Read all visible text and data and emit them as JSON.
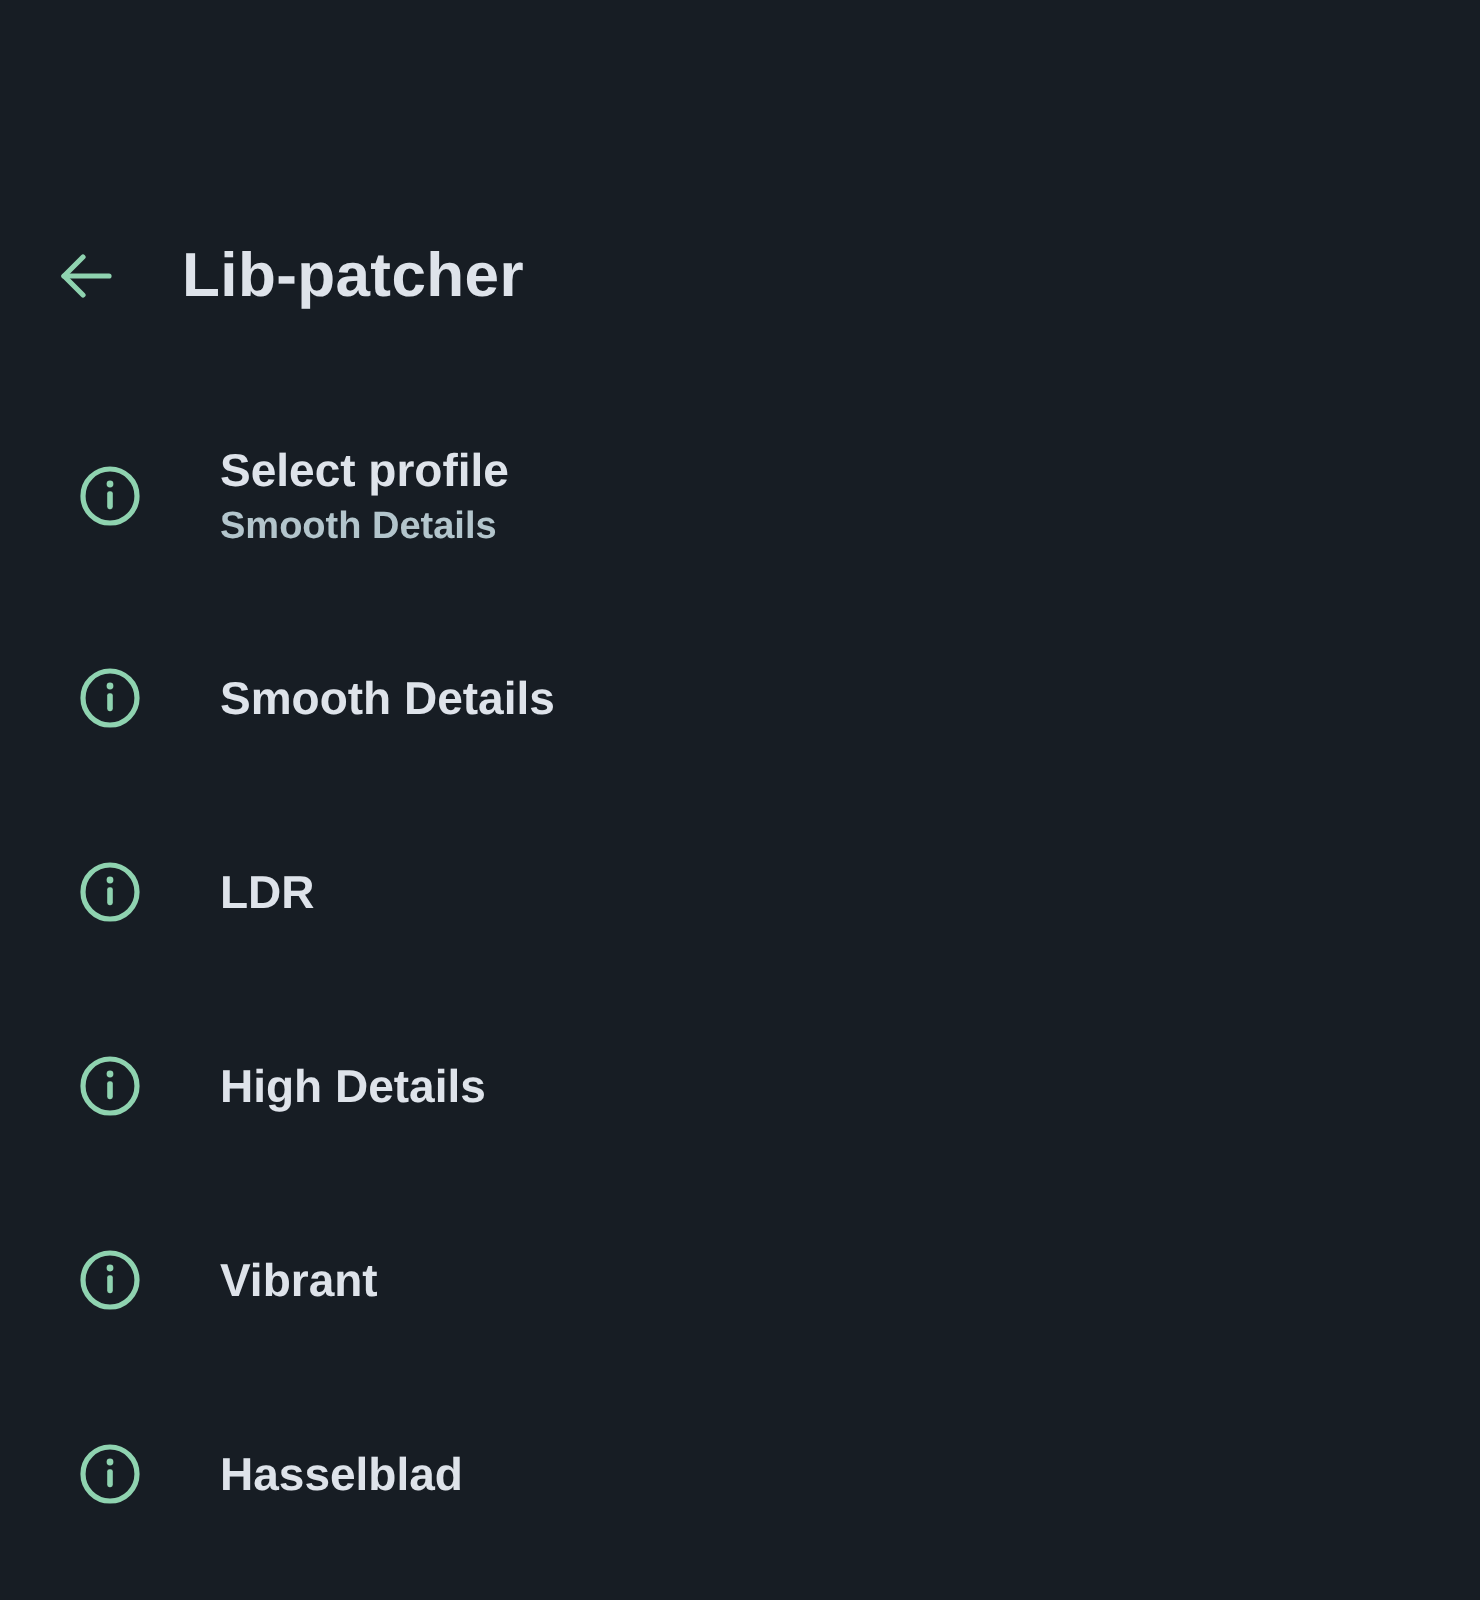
{
  "header": {
    "title": "Lib-patcher"
  },
  "items": [
    {
      "title": "Select profile",
      "summary": "Smooth Details"
    },
    {
      "title": "Smooth Details"
    },
    {
      "title": "LDR"
    },
    {
      "title": "High Details"
    },
    {
      "title": "Vibrant"
    },
    {
      "title": "Hasselblad"
    }
  ]
}
